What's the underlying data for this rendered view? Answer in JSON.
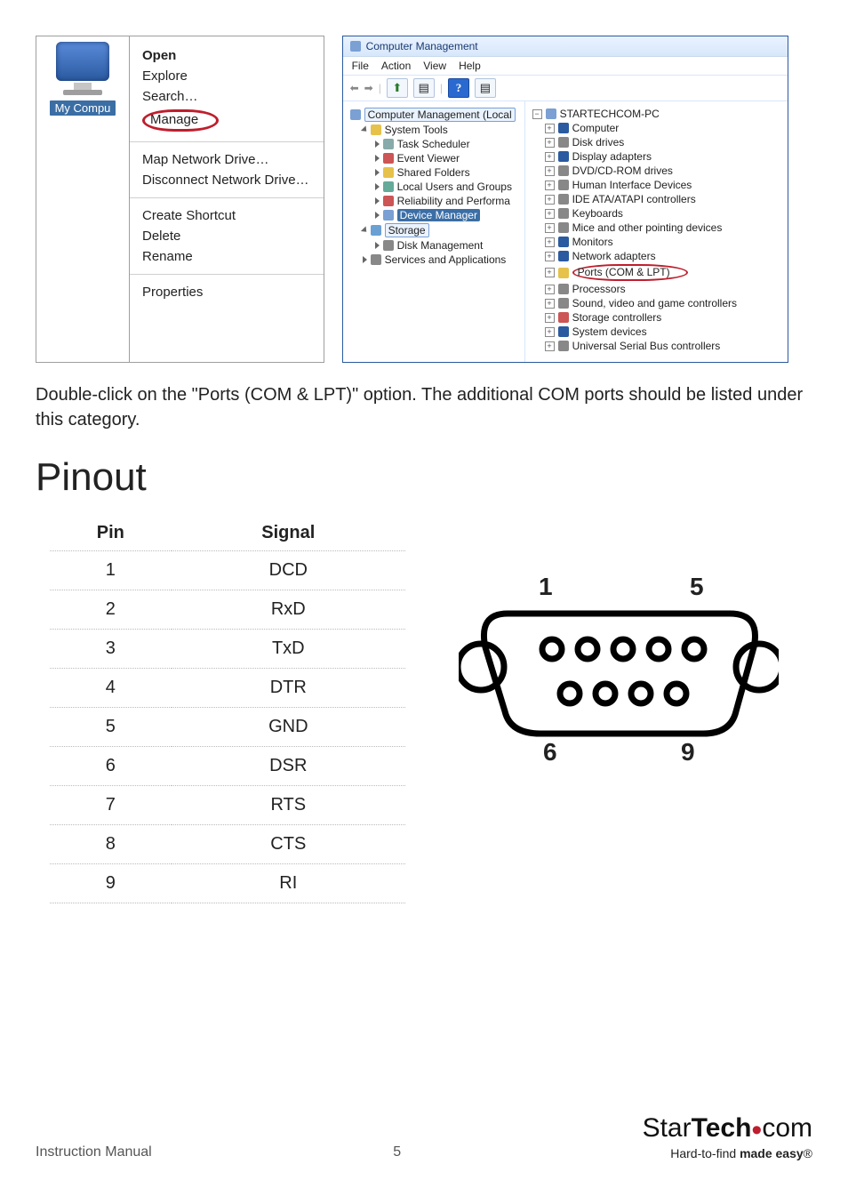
{
  "context_menu": {
    "desktop_label": "My Compu",
    "items": [
      {
        "label": "Open",
        "bold": true
      },
      {
        "label": "Explore"
      },
      {
        "label": "Search…"
      },
      {
        "label": "Manage",
        "circled": true
      },
      {
        "sep": true
      },
      {
        "label": "Map Network Drive…"
      },
      {
        "label": "Disconnect Network Drive…"
      },
      {
        "sep": true
      },
      {
        "label": "Create Shortcut"
      },
      {
        "label": "Delete"
      },
      {
        "label": "Rename"
      },
      {
        "sep": true
      },
      {
        "label": "Properties"
      }
    ]
  },
  "mmc": {
    "title": "Computer Management",
    "menus": [
      "File",
      "Action",
      "View",
      "Help"
    ],
    "left_tree": [
      {
        "label": "Computer Management (Local",
        "lvl": 0,
        "icon": "#7aa0d4",
        "highlight": "box"
      },
      {
        "label": "System Tools",
        "lvl": 1,
        "icon": "#e6c24a",
        "open": true
      },
      {
        "label": "Task Scheduler",
        "lvl": 2,
        "icon": "#8aa"
      },
      {
        "label": "Event Viewer",
        "lvl": 2,
        "icon": "#c55"
      },
      {
        "label": "Shared Folders",
        "lvl": 2,
        "icon": "#e6c24a"
      },
      {
        "label": "Local Users and Groups",
        "lvl": 2,
        "icon": "#6a9"
      },
      {
        "label": "Reliability and Performa",
        "lvl": 2,
        "icon": "#c55"
      },
      {
        "label": "Device Manager",
        "lvl": 2,
        "icon": "#7aa0d4",
        "highlight": "blue"
      },
      {
        "label": "Storage",
        "lvl": 1,
        "icon": "#6aa0d4",
        "open": true,
        "highlight": "box"
      },
      {
        "label": "Disk Management",
        "lvl": 2,
        "icon": "#888"
      },
      {
        "label": "Services and Applications",
        "lvl": 1,
        "icon": "#888"
      }
    ],
    "right_tree_root": "STARTECHCOM-PC",
    "right_tree": [
      {
        "label": "Computer",
        "icon": "#2a5aa0"
      },
      {
        "label": "Disk drives",
        "icon": "#888"
      },
      {
        "label": "Display adapters",
        "icon": "#2a5aa0"
      },
      {
        "label": "DVD/CD-ROM drives",
        "icon": "#888"
      },
      {
        "label": "Human Interface Devices",
        "icon": "#888"
      },
      {
        "label": "IDE ATA/ATAPI controllers",
        "icon": "#888"
      },
      {
        "label": "Keyboards",
        "icon": "#888"
      },
      {
        "label": "Mice and other pointing devices",
        "icon": "#888"
      },
      {
        "label": "Monitors",
        "icon": "#2a5aa0"
      },
      {
        "label": "Network adapters",
        "icon": "#2a5aa0"
      },
      {
        "label": "Ports (COM & LPT)",
        "icon": "#e6c24a",
        "circled": true
      },
      {
        "label": "Processors",
        "icon": "#888"
      },
      {
        "label": "Sound, video and game controllers",
        "icon": "#888"
      },
      {
        "label": "Storage controllers",
        "icon": "#c55"
      },
      {
        "label": "System devices",
        "icon": "#2a5aa0"
      },
      {
        "label": "Universal Serial Bus controllers",
        "icon": "#888"
      }
    ]
  },
  "instruction_text": "Double-click on the \"Ports (COM & LPT)\" option. The additional COM ports should be listed under this category.",
  "section_heading": "Pinout",
  "pin_table": {
    "headers": [
      "Pin",
      "Signal"
    ],
    "rows": [
      [
        "1",
        "DCD"
      ],
      [
        "2",
        "RxD"
      ],
      [
        "3",
        "TxD"
      ],
      [
        "4",
        "DTR"
      ],
      [
        "5",
        "GND"
      ],
      [
        "6",
        "DSR"
      ],
      [
        "7",
        "RTS"
      ],
      [
        "8",
        "CTS"
      ],
      [
        "9",
        "RI"
      ]
    ]
  },
  "db9_labels": {
    "tl": "1",
    "tr": "5",
    "bl": "6",
    "br": "9"
  },
  "footer": {
    "left": "Instruction Manual",
    "page": "5",
    "brand_a": "Star",
    "brand_b": "Tech",
    "brand_c": "com",
    "tagline_a": "Hard-to-find ",
    "tagline_b": "made easy",
    "tagline_c": "®"
  }
}
